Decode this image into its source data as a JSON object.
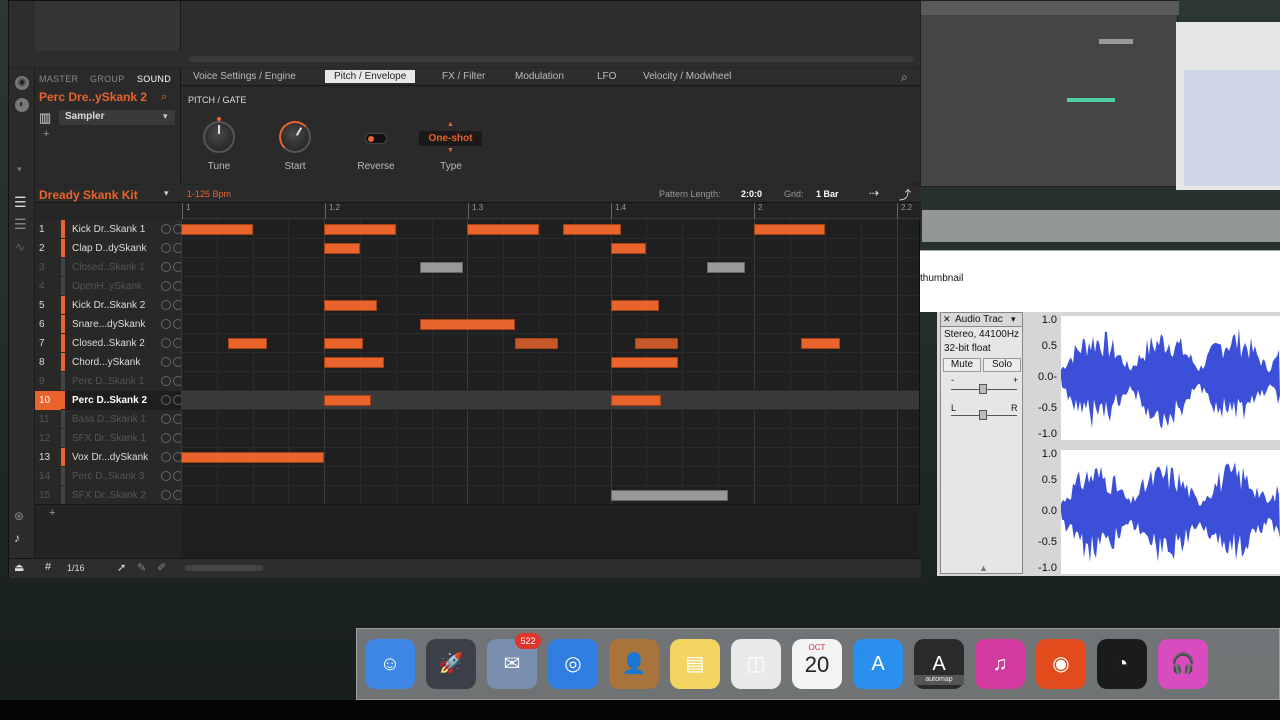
{
  "sound_panel": {
    "tabs": [
      "MASTER",
      "GROUP",
      "SOUND"
    ],
    "sound_name": "Perc Dre..ySkank 2",
    "plugin": "Sampler"
  },
  "param_tabs": [
    "Voice Settings / Engine",
    "Pitch / Envelope",
    "FX / Filter",
    "Modulation",
    "LFO",
    "Velocity / Modwheel"
  ],
  "pitch": {
    "section": "PITCH / GATE",
    "knobs": [
      {
        "label": "Tune"
      },
      {
        "label": "Start"
      }
    ],
    "reverse_label": "Reverse",
    "type_value": "One-shot",
    "type_label": "Type"
  },
  "pattern": {
    "kit_name": "Dready Skank Kit",
    "bpm": "1-125 Bpm",
    "length_label": "Pattern Length:",
    "length_value": "2:0:0",
    "grid_label": "Grid:",
    "grid_value": "1 Bar",
    "ruler": [
      "1",
      "1.2",
      "1.3",
      "1.4",
      "2",
      "2.2"
    ],
    "step": "1/16"
  },
  "tracks": [
    {
      "num": "1",
      "name": "Kick Dr..Skank 1",
      "active": true
    },
    {
      "num": "2",
      "name": "Clap D..dySkank",
      "active": true
    },
    {
      "num": "3",
      "name": "Closed..Skank 1",
      "active": false
    },
    {
      "num": "4",
      "name": "OpenH..ySkank",
      "active": false
    },
    {
      "num": "5",
      "name": "Kick Dr..Skank 2",
      "active": true
    },
    {
      "num": "6",
      "name": "Snare...dySkank",
      "active": true
    },
    {
      "num": "7",
      "name": "Closed..Skank 2",
      "active": true
    },
    {
      "num": "8",
      "name": "Chord...ySkank",
      "active": true
    },
    {
      "num": "9",
      "name": "Perc D..Skank 1",
      "active": false
    },
    {
      "num": "10",
      "name": "Perc D..Skank 2",
      "active": true,
      "selected": true
    },
    {
      "num": "11",
      "name": "Bass D..Skank 1",
      "active": false
    },
    {
      "num": "12",
      "name": "SFX Dr..Skank 1",
      "active": false
    },
    {
      "num": "13",
      "name": "Vox Dr...dySkank",
      "active": true
    },
    {
      "num": "14",
      "name": "Perc D..Skank 3",
      "active": false
    },
    {
      "num": "15",
      "name": "SFX Dr..Skank 2",
      "active": false
    }
  ],
  "notes": [
    {
      "row": 0,
      "start": 0,
      "len": 0.5
    },
    {
      "row": 0,
      "start": 1,
      "len": 0.5
    },
    {
      "row": 0,
      "start": 2,
      "len": 0.5
    },
    {
      "row": 0,
      "start": 2.67,
      "len": 0.4
    },
    {
      "row": 0,
      "start": 4,
      "len": 0.5
    },
    {
      "row": 1,
      "start": 1,
      "len": 0.25
    },
    {
      "row": 1,
      "start": 3,
      "len": 0.25
    },
    {
      "row": 2,
      "start": 1.67,
      "len": 0.3,
      "dim": true
    },
    {
      "row": 2,
      "start": 3.67,
      "len": 0.27,
      "dim": true
    },
    {
      "row": 4,
      "start": 1,
      "len": 0.37
    },
    {
      "row": 4,
      "start": 3,
      "len": 0.34
    },
    {
      "row": 5,
      "start": 1.67,
      "len": 0.66
    },
    {
      "row": 6,
      "start": 0.33,
      "len": 0.27
    },
    {
      "row": 6,
      "start": 1,
      "len": 0.27
    },
    {
      "row": 6,
      "start": 2.33,
      "len": 0.3,
      "mid": true
    },
    {
      "row": 6,
      "start": 3.17,
      "len": 0.3,
      "mid": true
    },
    {
      "row": 6,
      "start": 4.33,
      "len": 0.27
    },
    {
      "row": 7,
      "start": 1,
      "len": 0.42
    },
    {
      "row": 7,
      "start": 3,
      "len": 0.47
    },
    {
      "row": 9,
      "start": 1,
      "len": 0.33
    },
    {
      "row": 9,
      "start": 3,
      "len": 0.35
    },
    {
      "row": 12,
      "start": 0,
      "len": 1
    },
    {
      "row": 14,
      "start": 3,
      "len": 0.82,
      "dim": true
    }
  ],
  "audacity": {
    "track_name": "Audio Trac",
    "format": "Stereo, 44100Hz",
    "bit": "32-bit float",
    "mute": "Mute",
    "solo": "Solo",
    "scale": [
      "1.0",
      "0.5",
      "0.0-",
      "-0.5",
      "-1.0"
    ],
    "scale2": [
      "1.0",
      "0.5",
      "0.0",
      "-0.5",
      "-1.0"
    ],
    "pan_l": "L",
    "pan_r": "R",
    "gain_minus": "-",
    "gain_plus": "+"
  },
  "thumbnail_label": "thumbnail",
  "dock": {
    "badge": "522",
    "cal_month": "OCT",
    "cal_day": "20",
    "icons": [
      "finder-icon",
      "launchpad-icon",
      "mail-icon",
      "safari-icon",
      "contacts-icon",
      "notes-icon",
      "preview-icon",
      "calendar-icon",
      "appstore-icon",
      "automap-icon",
      "itunes-icon",
      "record-icon",
      "obs-icon",
      "audacity-icon"
    ],
    "automap_label": "automap"
  },
  "colors": {
    "accent": "#e8642c",
    "window": "#262626"
  }
}
